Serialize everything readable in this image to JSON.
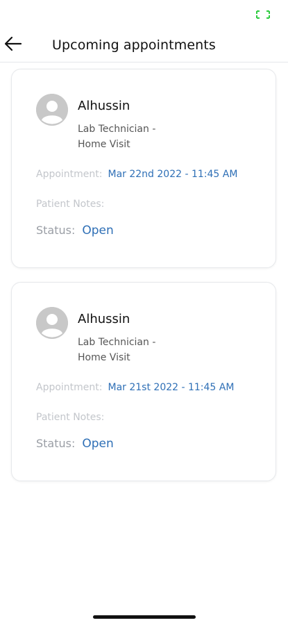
{
  "header": {
    "title": "Upcoming appointments",
    "back_icon": "arrow-left-icon"
  },
  "status_bar": {
    "indicator_icon": "expand-brackets-icon",
    "indicator_color": "#2ecc40"
  },
  "colors": {
    "accent": "#2e6fb6",
    "muted": "#c3c6cb",
    "status_label": "#9a9ea5"
  },
  "appointments": [
    {
      "name": "Alhussin",
      "role": "Lab Technician - Home Visit",
      "appointment_label": "Appointment:",
      "appointment_value": "Mar 22nd 2022 - 11:45 AM",
      "notes_label": "Patient Notes:",
      "status_label": "Status:",
      "status_value": "Open",
      "avatar_icon": "user-avatar-icon"
    },
    {
      "name": "Alhussin",
      "role": "Lab Technician - Home Visit",
      "appointment_label": "Appointment:",
      "appointment_value": "Mar 21st 2022 - 11:45 AM",
      "notes_label": "Patient Notes:",
      "status_label": "Status:",
      "status_value": "Open",
      "avatar_icon": "user-avatar-icon"
    }
  ]
}
